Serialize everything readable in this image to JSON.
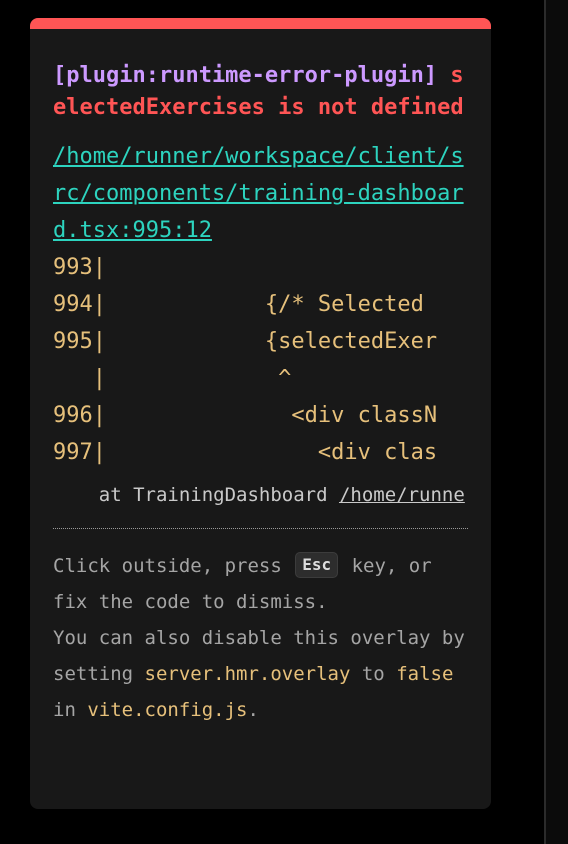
{
  "overlay": {
    "plugin": "[plugin:runtime-error-plugin]",
    "message": "selectedExercises is not defined",
    "file": "/home/runner/workspace/client/src/components/training-dashboard.tsx:995:12",
    "frame": "993|\n994|            {/* Selected\n995|            {selectedExer\n   |             ^\n996|              <div classN\n997|                <div clas",
    "stack_prefix": "    at TrainingDashboard ",
    "stack_path": "/home/runne",
    "tip": {
      "line1_pre": "Click outside, press ",
      "key": "Esc",
      "line1_post": " key, or fix the code to dismiss.",
      "line2_pre": "You can also disable this overlay by setting ",
      "config_option": "server.hmr.overlay",
      "line2_mid": " to ",
      "config_value": "false",
      "line2_in": " in ",
      "config_file": "vite.config.js",
      "line2_end": "."
    }
  },
  "colors": {
    "background": "#000000",
    "window": "#181818",
    "accent_bar": "#ff5555",
    "plugin": "#cc99ff",
    "error": "#ff5555",
    "file_link": "#2dd4bf",
    "code": "#e6c07b",
    "stack": "#c9c9c9",
    "tip": "#a5a5a5"
  }
}
